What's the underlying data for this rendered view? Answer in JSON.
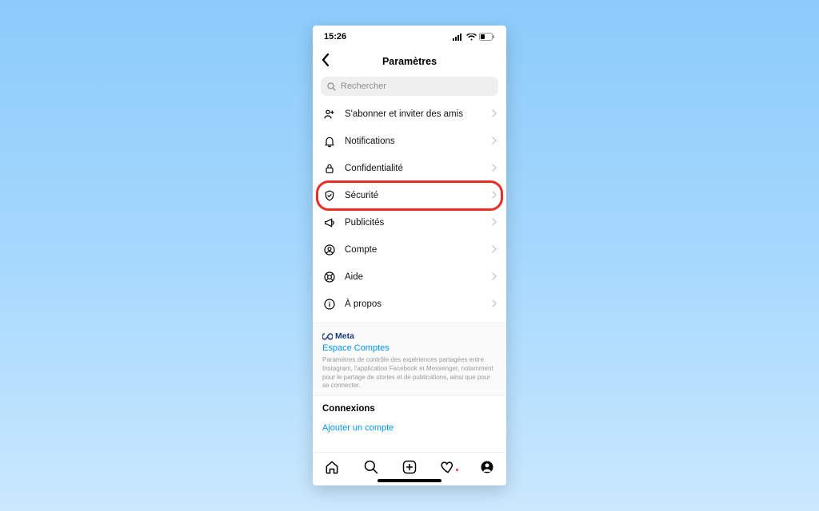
{
  "status": {
    "time": "15:26"
  },
  "nav": {
    "title": "Paramètres"
  },
  "search": {
    "placeholder": "Rechercher"
  },
  "rows": {
    "invite": "S'abonner et inviter des amis",
    "notif": "Notifications",
    "privacy": "Confidentialité",
    "security": "Sécurité",
    "ads": "Publicités",
    "account": "Compte",
    "help": "Aide",
    "about": "À propos"
  },
  "meta": {
    "brand": "Meta",
    "link": "Espace Comptes",
    "desc": "Paramètres de contrôle des expériences partagées entre Instagram, l'application Facebook et Messenger, notamment pour le partage de stories et de publications, ainsi que pour se connecter."
  },
  "connexions": {
    "header": "Connexions",
    "add": "Ajouter un compte"
  },
  "colors": {
    "highlight": "#ec2d26",
    "link": "#0095f6"
  }
}
